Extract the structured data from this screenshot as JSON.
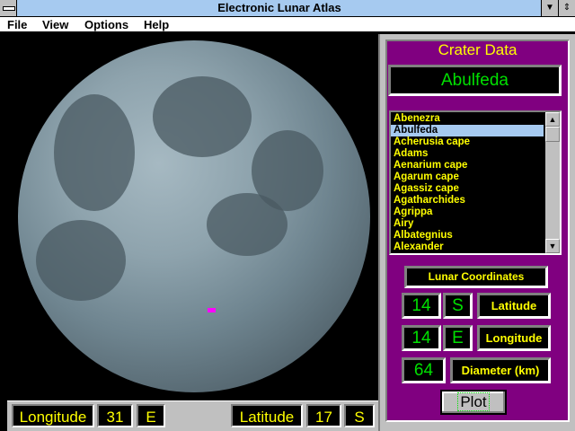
{
  "window": {
    "title": "Electronic Lunar Atlas"
  },
  "menu": [
    "File",
    "View",
    "Options",
    "Help"
  ],
  "status": {
    "lon_label": "Longitude",
    "lon_value": "31",
    "lon_dir": "E",
    "lat_label": "Latitude",
    "lat_value": "17",
    "lat_dir": "S"
  },
  "panel": {
    "title": "Crater Data",
    "selected_crater": "Abulfeda",
    "craters": [
      "Abenezra",
      "Abulfeda",
      "Acherusia cape",
      "Adams",
      "Aenarium cape",
      "Agarum cape",
      "Agassiz cape",
      "Agatharchides",
      "Agrippa",
      "Airy",
      "Albategnius",
      "Alexander"
    ],
    "coords_label": "Lunar Coordinates",
    "latitude": {
      "value": "14",
      "dir": "S",
      "label": "Latitude"
    },
    "longitude": {
      "value": "14",
      "dir": "E",
      "label": "Longitude"
    },
    "diameter": {
      "value": "64",
      "label": "Diameter (km)"
    },
    "plot_label": "Plot"
  },
  "colors": {
    "panel": "#800080",
    "highlight": "#a6caf0",
    "marker": "#ff00ff"
  }
}
